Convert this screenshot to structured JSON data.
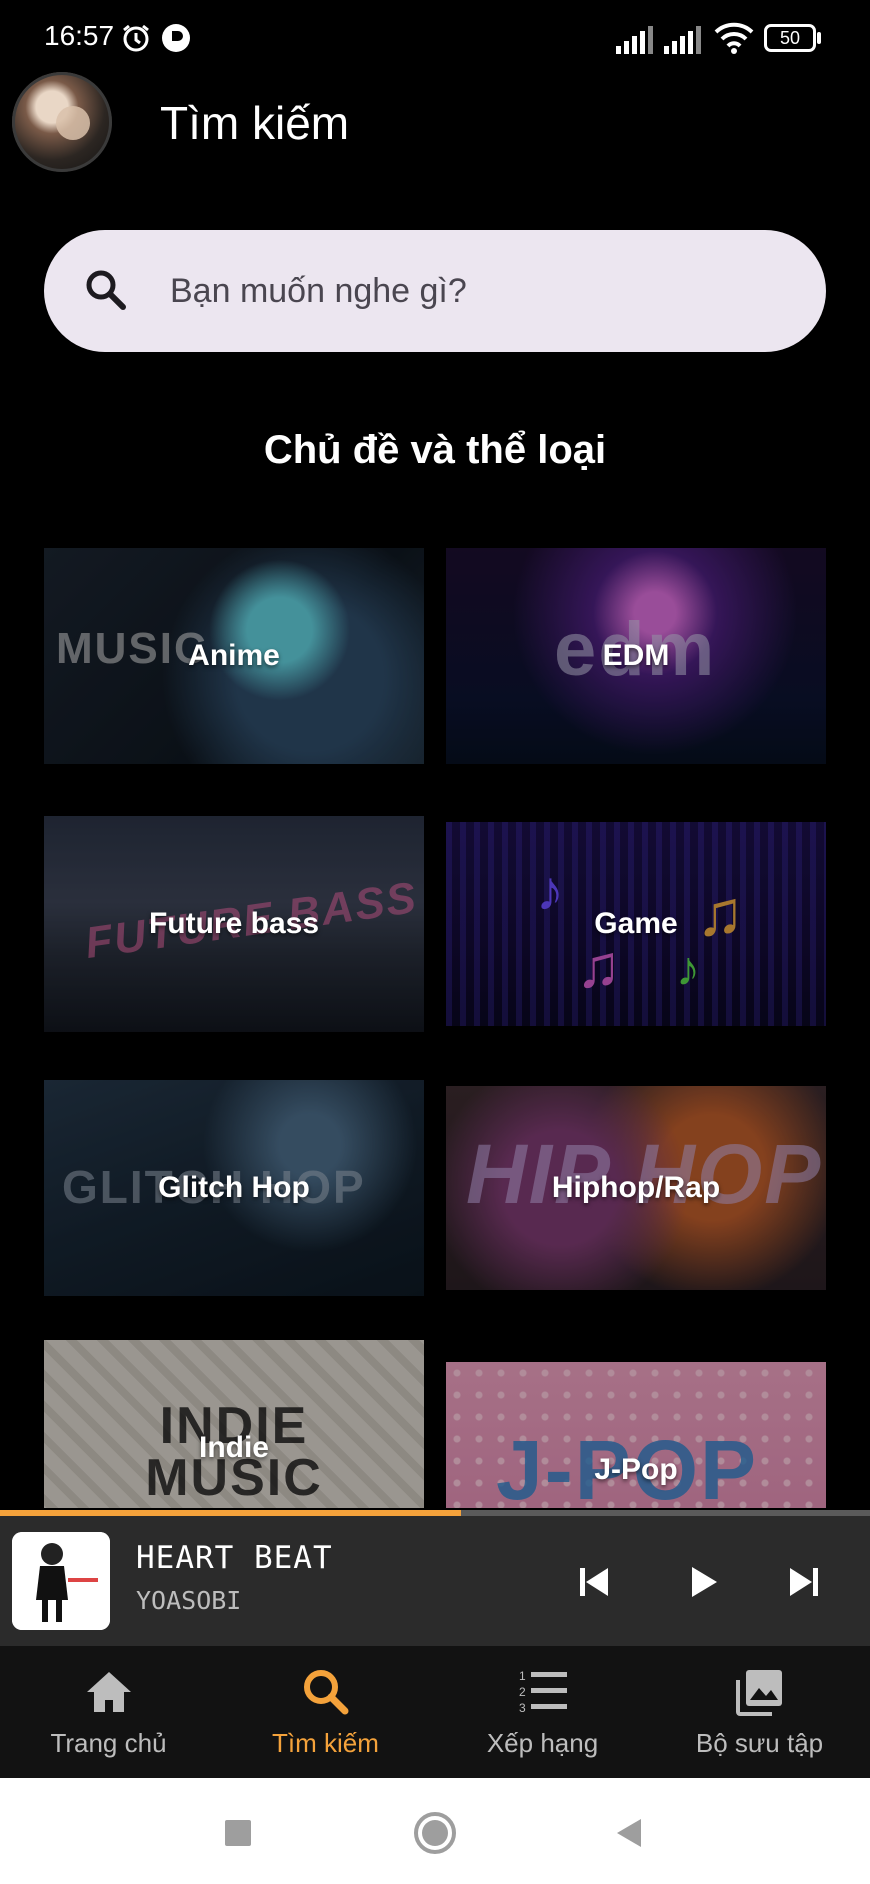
{
  "status_bar": {
    "time": "16:57",
    "battery": "50",
    "icons": [
      "alarm-icon",
      "app-notification-icon",
      "signal-icon",
      "signal-icon",
      "wifi-icon",
      "battery-icon"
    ]
  },
  "header": {
    "title": "Tìm kiếm",
    "avatar_icon": "profile-avatar"
  },
  "search": {
    "placeholder": "Bạn muốn nghe gì?",
    "icon": "search-icon"
  },
  "section": {
    "title": "Chủ đề và thể loại"
  },
  "genres": [
    {
      "label": "Anime",
      "art_text": "MUSIC"
    },
    {
      "label": "EDM",
      "art_text": "edm"
    },
    {
      "label": "Future bass",
      "art_text": "FUTURE BASS"
    },
    {
      "label": "Game",
      "art_text": ""
    },
    {
      "label": "Glitch Hop",
      "art_text": "GLITCH HOP"
    },
    {
      "label": "Hiphop/Rap",
      "art_text": "HIP HOP"
    },
    {
      "label": "Indie",
      "art_text": "INDIE MUSIC"
    },
    {
      "label": "J-Pop",
      "art_text": "J-POP"
    }
  ],
  "player": {
    "title": "HEART BEAT",
    "artist": "YOASOBI",
    "progress": 0.53,
    "colors": {
      "progress": "#f4a23b",
      "track": "#5a5a5a",
      "background": "#2b2b2b"
    }
  },
  "bottom_nav": {
    "items": [
      {
        "label": "Trang chủ",
        "icon": "home-icon",
        "active": false
      },
      {
        "label": "Tìm kiếm",
        "icon": "search-icon",
        "active": true
      },
      {
        "label": "Xếp hạng",
        "icon": "ranking-list-icon",
        "active": false
      },
      {
        "label": "Bộ sưu tập",
        "icon": "library-icon",
        "active": false
      }
    ],
    "active_color": "#f4a23b"
  },
  "system_nav": {
    "buttons": [
      "recents-icon",
      "home-circle-icon",
      "back-icon"
    ]
  }
}
